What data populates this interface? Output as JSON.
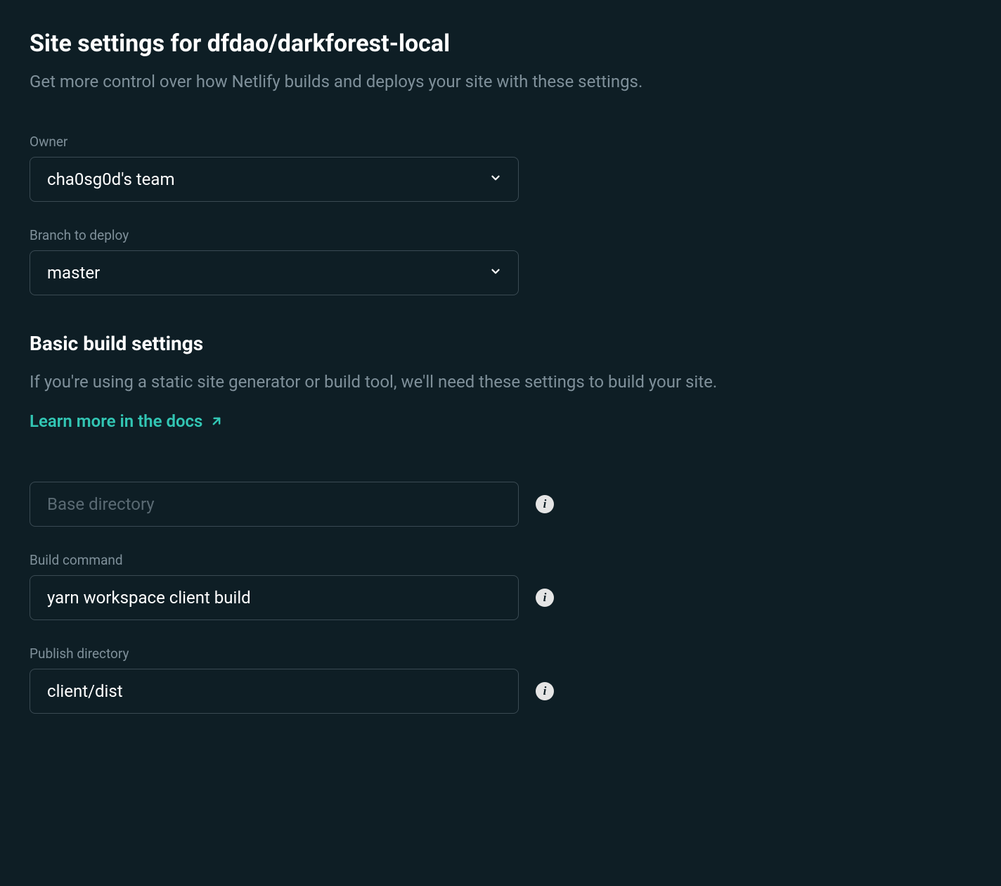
{
  "header": {
    "title": "Site settings for dfdao/darkforest-local",
    "subtitle": "Get more control over how Netlify builds and deploys your site with these settings."
  },
  "fields": {
    "owner": {
      "label": "Owner",
      "value": "cha0sg0d's team"
    },
    "branch": {
      "label": "Branch to deploy",
      "value": "master"
    }
  },
  "build_section": {
    "title": "Basic build settings",
    "subtitle": "If you're using a static site generator or build tool, we'll need these settings to build your site.",
    "docs_link": "Learn more in the docs"
  },
  "build_fields": {
    "base_directory": {
      "placeholder": "Base directory",
      "value": ""
    },
    "build_command": {
      "label": "Build command",
      "value": "yarn workspace client build"
    },
    "publish_directory": {
      "label": "Publish directory",
      "value": "client/dist"
    }
  }
}
